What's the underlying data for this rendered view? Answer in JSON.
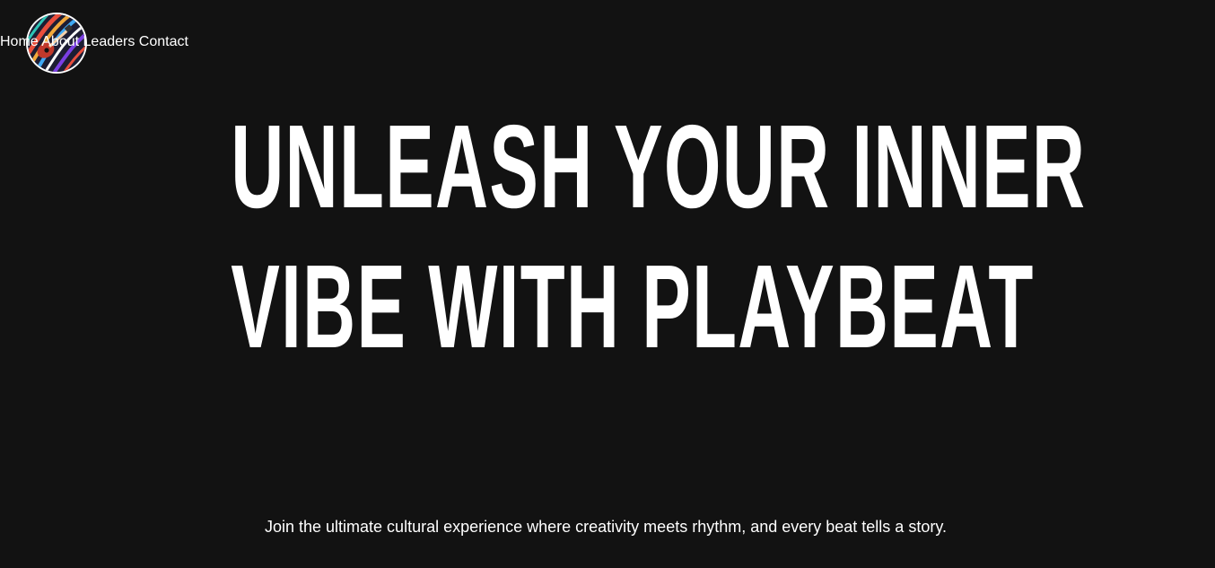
{
  "brand": {
    "logo_icon": "guitar-swirl-logo-icon"
  },
  "nav": {
    "home": "Home",
    "about": "About",
    "leaders": "Leaders",
    "contact": "Contact"
  },
  "hero": {
    "line1": "UNLEASH YOUR INNER",
    "line2": "VIBE WITH PLAYBEAT",
    "subtitle": "Join the ultimate cultural experience where creativity meets rhythm, and every beat tells a story."
  },
  "colors": {
    "background": "#121212",
    "text": "#ffffff"
  }
}
